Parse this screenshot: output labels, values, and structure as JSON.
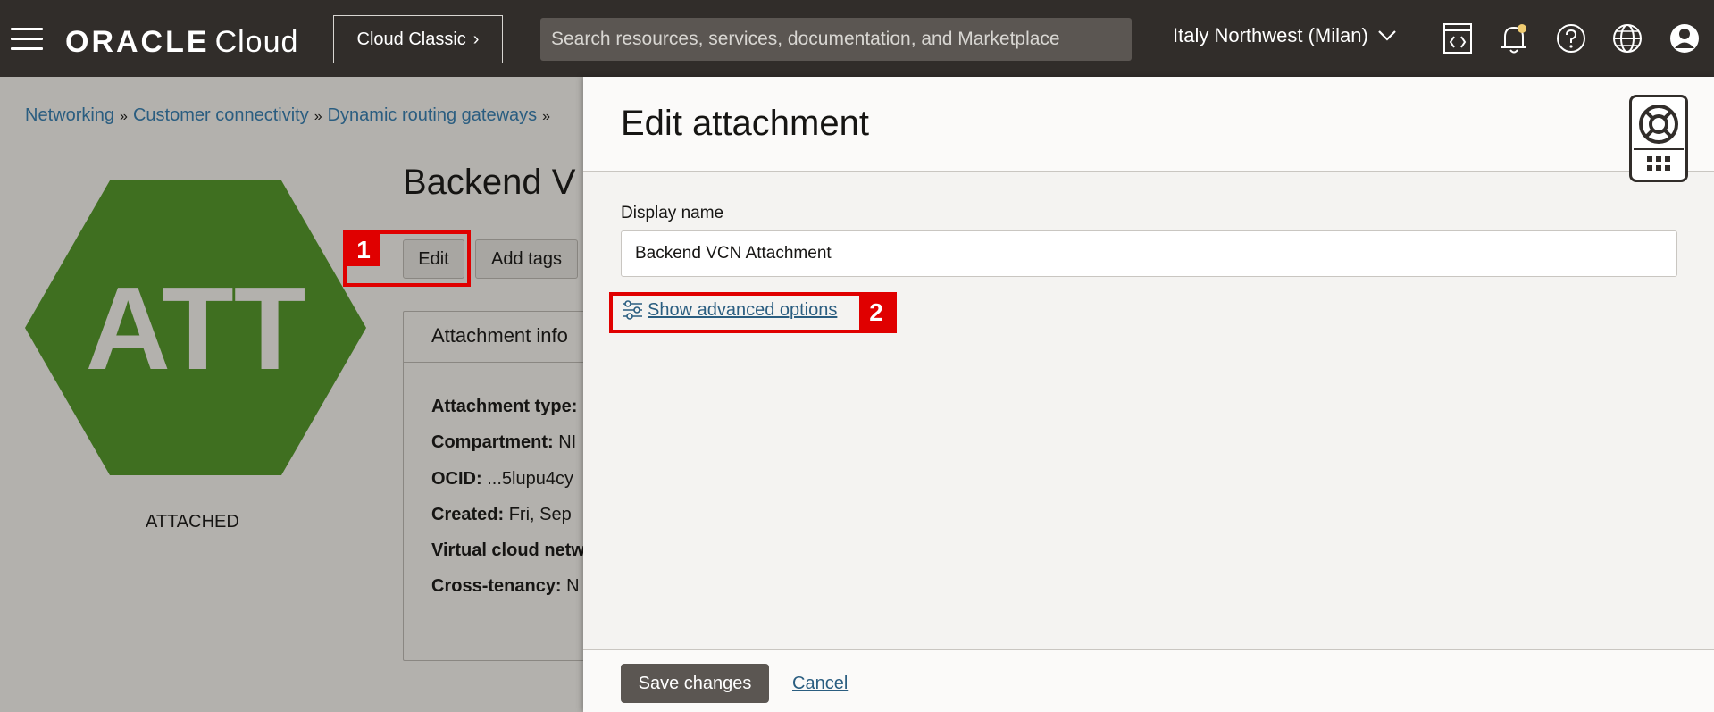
{
  "header": {
    "brand": "ORACLE",
    "product": "Cloud",
    "classic_button": "Cloud Classic",
    "search_placeholder": "Search resources, services, documentation, and Marketplace",
    "region": "Italy Northwest (Milan)"
  },
  "breadcrumbs": [
    "Networking",
    "Customer connectivity",
    "Dynamic routing gateways"
  ],
  "resource": {
    "icon_text": "ATT",
    "icon_color": "#3f6f20",
    "state": "ATTACHED",
    "title": "Backend V",
    "edit_button": "Edit",
    "add_tags_button": "Add tags",
    "info_tab": "Attachment info",
    "info_lines": [
      {
        "label": "Attachment type:",
        "value": ""
      },
      {
        "label": "Compartment:",
        "value": " NI"
      },
      {
        "label": "OCID:",
        "value": " ...5lupu4cy"
      },
      {
        "label": "Created:",
        "value": " Fri, Sep"
      },
      {
        "label": "Virtual cloud netw",
        "value": ""
      },
      {
        "label": "Cross-tenancy:",
        "value": " N"
      }
    ]
  },
  "panel": {
    "title": "Edit attachment",
    "display_name_label": "Display name",
    "display_name_value": "Backend VCN Attachment",
    "advanced_link": "Show advanced options",
    "save_button": "Save changes",
    "cancel_link": "Cancel"
  },
  "callouts": [
    "1",
    "2"
  ],
  "colors": {
    "header_bg": "#312d2a",
    "link": "#2a5d80",
    "callout": "#e00000",
    "save_bg": "#5b5652"
  }
}
